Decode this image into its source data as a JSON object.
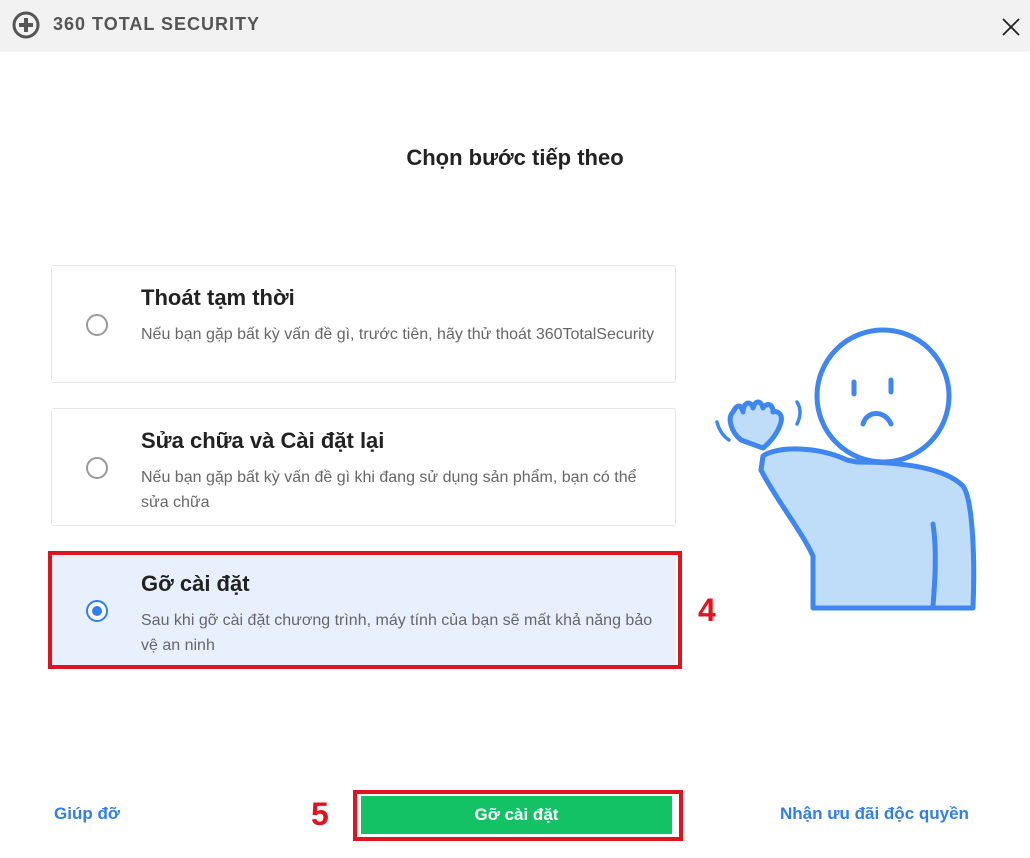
{
  "app": {
    "brand": "360 TOTAL SECURITY",
    "logo_icon": "plus-circle-icon",
    "close_icon": "close-icon"
  },
  "heading": "Chọn bước tiếp theo",
  "options": [
    {
      "title": "Thoát tạm thời",
      "description": "Nếu bạn gặp bất kỳ vấn đề gì, trước tiên, hãy thử thoát 360TotalSecurity",
      "selected": false
    },
    {
      "title": "Sửa chữa và Cài đặt lại",
      "description": "Nếu bạn gặp bất kỳ vấn đề gì khi đang sử dụng sản phẩm, bạn có thể sửa chữa",
      "selected": false
    },
    {
      "title": "Gỡ cài đặt",
      "description": "Sau khi gỡ cài đặt chương trình, máy tính của bạn sẽ mất khả năng bảo vệ an ninh",
      "selected": true
    }
  ],
  "annotations": {
    "step_4": "4",
    "step_5": "5",
    "highlight_color": "#e0141f"
  },
  "footer": {
    "help_link": "Giúp đỡ",
    "uninstall_button": "Gỡ cài đặt",
    "offer_link": "Nhận ưu đãi độc quyền"
  },
  "colors": {
    "accent_blue": "#2f80ed",
    "button_green": "#14c266",
    "link_blue": "#2f7fe8",
    "selected_bg": "#e9f0fd"
  },
  "illustration": "waving-sad-person-illustration"
}
